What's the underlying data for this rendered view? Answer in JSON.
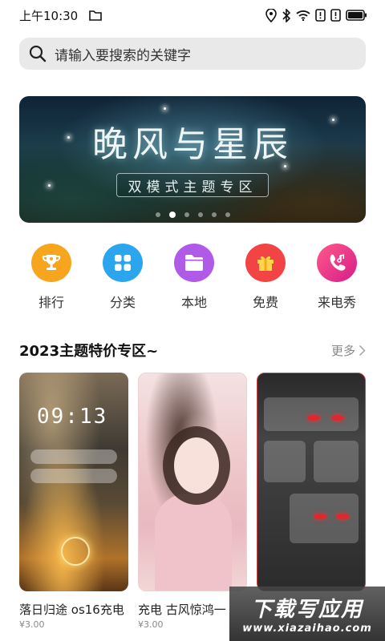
{
  "status_bar": {
    "time": "上午10:30",
    "icons": [
      "folder-icon",
      "location-icon",
      "bluetooth-icon",
      "wifi-icon",
      "alert-icon",
      "alert-icon",
      "battery-icon"
    ]
  },
  "search": {
    "placeholder": "请输入要搜索的关键字"
  },
  "banner": {
    "title": "晚风与星辰",
    "subtitle": "双模式主题专区",
    "page_count": 6,
    "active_page": 2
  },
  "categories": [
    {
      "label": "排行",
      "icon": "trophy-icon",
      "color": "#f8a51e"
    },
    {
      "label": "分类",
      "icon": "grid-icon",
      "color": "#2aa5ee"
    },
    {
      "label": "本地",
      "icon": "folder-icon",
      "color": "#b05ae8"
    },
    {
      "label": "免费",
      "icon": "gift-icon",
      "color": "#f24444"
    },
    {
      "label": "来电秀",
      "icon": "phone-icon",
      "color": "#ea2c8a"
    }
  ],
  "section": {
    "title": "2023主题特价专区~",
    "more": "更多"
  },
  "cards": [
    {
      "title": "落日归途 os16充电",
      "price": "¥3.00",
      "clock": "09:13"
    },
    {
      "title": "充电 古风惊鸿一",
      "price": "¥3.00"
    },
    {
      "title": "",
      "price": ""
    }
  ],
  "watermark": {
    "big": "下载写应用",
    "small": "www.xiazaihao.com"
  }
}
